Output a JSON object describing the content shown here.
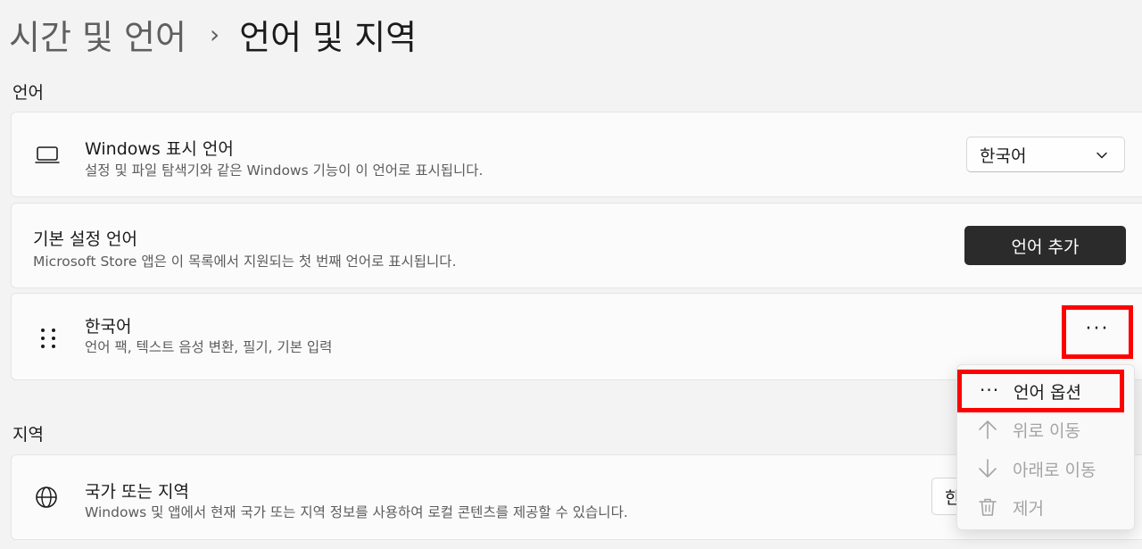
{
  "breadcrumb": {
    "parent": "시간 및 언어",
    "separator": "›",
    "current": "언어 및 지역"
  },
  "sections": {
    "language": "언어",
    "region": "지역"
  },
  "display_language": {
    "icon": "laptop-icon",
    "title": "Windows 표시 언어",
    "subtitle": "설정 및 파일 탐색기와 같은 Windows 기능이 이 언어로 표시됩니다.",
    "selected": "한국어"
  },
  "preferred_languages": {
    "title": "기본 설정 언어",
    "subtitle": "Microsoft Store 앱은 이 목록에서 지원되는 첫 번째 언어로 표시됩니다.",
    "add_button": "언어 추가"
  },
  "korean_language": {
    "icon": "drag-handle-icon",
    "title": "한국어",
    "subtitle": "언어 팩, 텍스트 음성 변환, 필기, 기본 입력",
    "more_button": "···"
  },
  "context_menu": {
    "items": [
      {
        "label": "언어 옵션",
        "icon": "more-icon",
        "enabled": true
      },
      {
        "label": "위로 이동",
        "icon": "arrow-up-icon",
        "enabled": false
      },
      {
        "label": "아래로 이동",
        "icon": "arrow-down-icon",
        "enabled": false
      },
      {
        "label": "제거",
        "icon": "trash-icon",
        "enabled": false
      }
    ]
  },
  "country_region": {
    "icon": "globe-icon",
    "title": "국가 또는 지역",
    "subtitle": "Windows 및 앱에서 현재 국가 또는 지역 정보를 사용하여 로컬 콘텐츠를 제공할 수 있습니다.",
    "selected_partial": "한"
  },
  "colors": {
    "accent_highlight": "#ff0000",
    "primary_button": "#2b2b2b",
    "background": "#f3f3f3"
  }
}
